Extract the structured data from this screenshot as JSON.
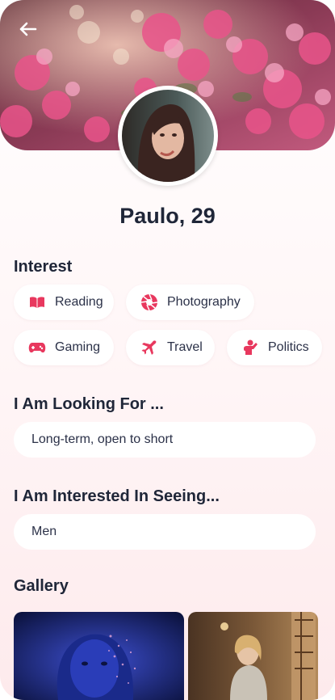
{
  "profile": {
    "name_age": "Paulo, 29"
  },
  "interest": {
    "title": "Interest",
    "items": [
      {
        "label": "Reading",
        "icon": "book-icon"
      },
      {
        "label": "Photography",
        "icon": "camera-aperture-icon"
      },
      {
        "label": "Gaming",
        "icon": "gamepad-icon"
      },
      {
        "label": "Travel",
        "icon": "airplane-icon"
      },
      {
        "label": "Politics",
        "icon": "speaker-person-icon"
      }
    ]
  },
  "looking_for": {
    "title": "I Am Looking For ...",
    "value": "Long-term, open to short"
  },
  "interested_in": {
    "title": "I Am Interested In Seeing...",
    "value": "Men"
  },
  "gallery": {
    "title": "Gallery"
  },
  "colors": {
    "accent": "#e8385e",
    "text": "#1f2638",
    "chip_bg": "#ffffff"
  }
}
